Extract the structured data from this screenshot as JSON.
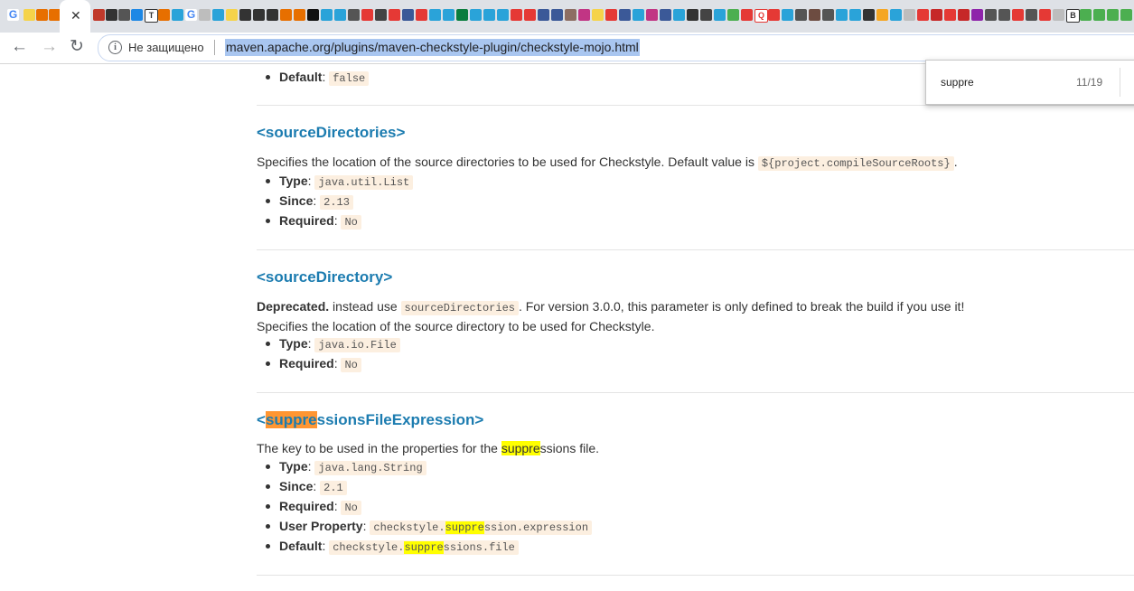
{
  "colors": {
    "accent": "#1c7cb0",
    "highlight": "#ffff00",
    "current_match": "#ff9632",
    "code_bg": "#fcefe0"
  },
  "toolbar": {
    "back_icon": "back-arrow-icon",
    "forward_icon": "forward-arrow-icon",
    "reload_icon": "reload-icon",
    "security_text": "Не защищено",
    "url": "maven.apache.org/plugins/maven-checkstyle-plugin/checkstyle-mojo.html"
  },
  "findbar": {
    "query": "suppre",
    "count": "11/19"
  },
  "top_section": {
    "default_label": "Default",
    "default_value": "false"
  },
  "sections": {
    "sourceDirectories": {
      "title": "<sourceDirectories>",
      "desc_text": "Specifies the location of the source directories to be used for Checkstyle. Default value is",
      "desc_code": "${project.compileSourceRoots}",
      "desc_end": ".",
      "type_label": "Type",
      "type_value": "java.util.List",
      "since_label": "Since",
      "since_value": "2.13",
      "required_label": "Required",
      "required_value": "No"
    },
    "sourceDirectory": {
      "title": "<sourceDirectory>",
      "deprecated": "Deprecated.",
      "dep_text1": "instead use",
      "dep_code": "sourceDirectories",
      "dep_text2": ". For version 3.0.0, this parameter is only defined to break the build if you use it!",
      "desc": "Specifies the location of the source directory to be used for Checkstyle.",
      "type_label": "Type",
      "type_value": "java.io.File",
      "required_label": "Required",
      "required_value": "No"
    },
    "suppressions": {
      "title_open": "<",
      "title_match": "suppre",
      "title_rest": "ssionsFileExpression>",
      "desc_pre": "The key to be used in the properties for the",
      "desc_match": "suppre",
      "desc_post": "ssions file.",
      "type_label": "Type",
      "type_value": "java.lang.String",
      "since_label": "Since",
      "since_value": "2.1",
      "required_label": "Required",
      "required_value": "No",
      "userprop_label": "User Property",
      "userprop_pre": "checkstyle.",
      "userprop_match": "suppre",
      "userprop_post": "ssion.expression",
      "default_label": "Default",
      "default_pre": "checkstyle.",
      "default_match": "suppre",
      "default_post": "ssions.file"
    }
  }
}
